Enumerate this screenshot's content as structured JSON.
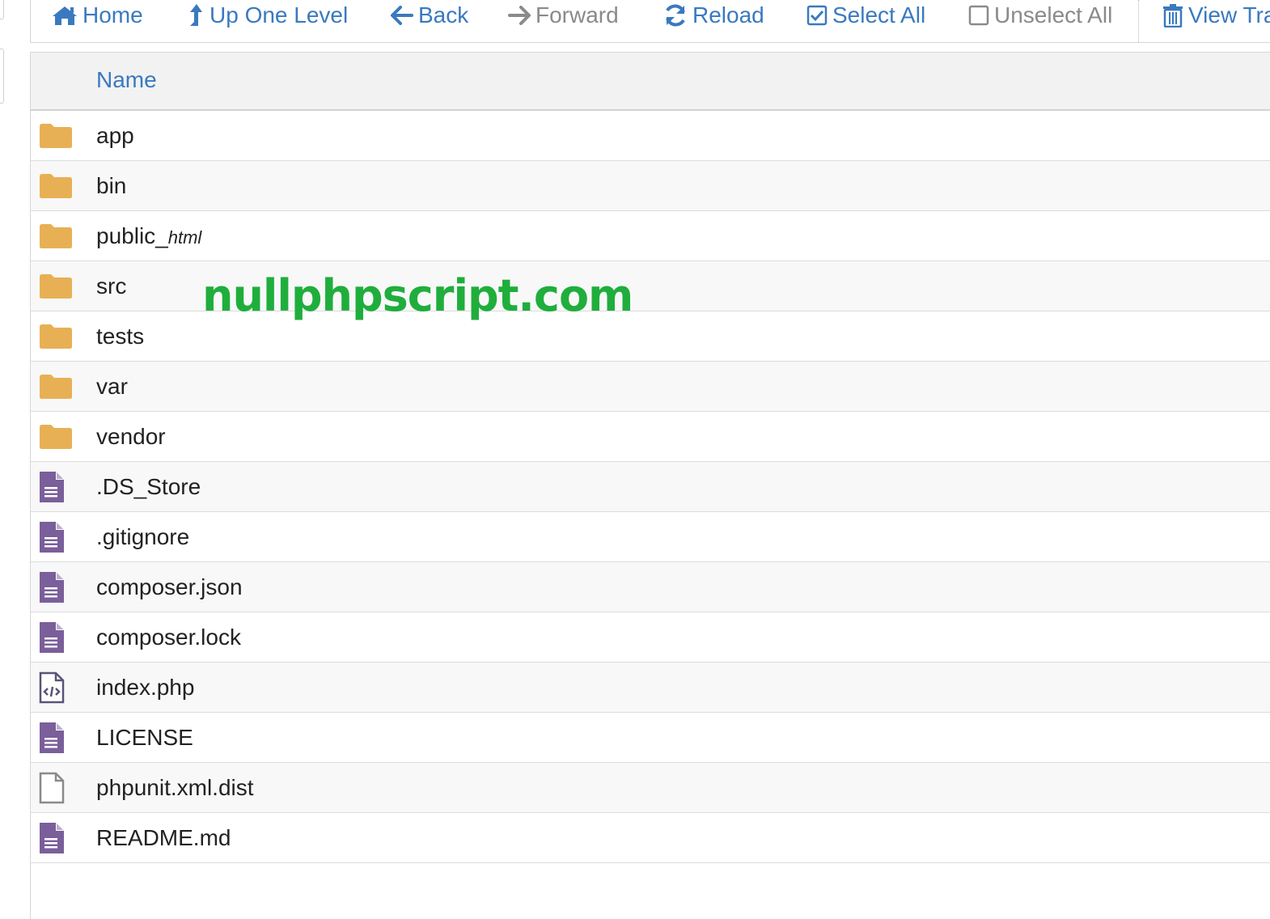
{
  "toolbar": {
    "home": "Home",
    "up_one_level": "Up One Level",
    "back": "Back",
    "forward": "Forward",
    "reload": "Reload",
    "select_all": "Select All",
    "unselect_all": "Unselect All",
    "view_trash": "View Tra"
  },
  "table": {
    "column_name": "Name"
  },
  "files": [
    {
      "name": "app",
      "type": "folder"
    },
    {
      "name": "bin",
      "type": "folder"
    },
    {
      "name": "public_",
      "suffix": "html",
      "type": "folder"
    },
    {
      "name": "src",
      "type": "folder"
    },
    {
      "name": "tests",
      "type": "folder"
    },
    {
      "name": "var",
      "type": "folder"
    },
    {
      "name": "vendor",
      "type": "folder"
    },
    {
      "name": ".DS_Store",
      "type": "text-file"
    },
    {
      "name": ".gitignore",
      "type": "text-file"
    },
    {
      "name": "composer.json",
      "type": "text-file"
    },
    {
      "name": "composer.lock",
      "type": "text-file"
    },
    {
      "name": "index.php",
      "type": "code-file"
    },
    {
      "name": "LICENSE",
      "type": "text-file"
    },
    {
      "name": "phpunit.xml.dist",
      "type": "blank-file"
    },
    {
      "name": "README.md",
      "type": "text-file"
    }
  ],
  "watermark": "nullphpscript.com",
  "colors": {
    "accent": "#3a79bf",
    "folder": "#e8b055",
    "file": "#7a5f9a",
    "watermark": "#1fae3c"
  }
}
